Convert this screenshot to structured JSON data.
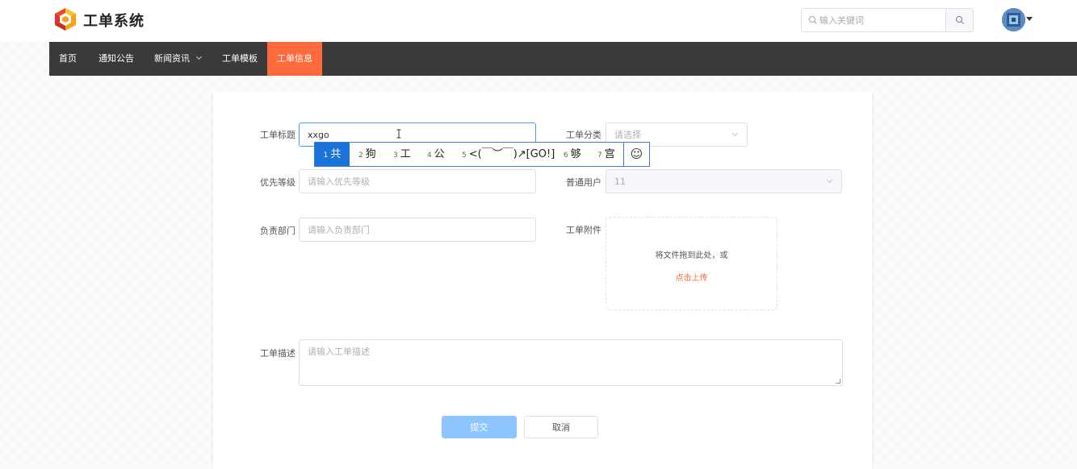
{
  "header": {
    "brand": "工单系统",
    "search_placeholder": "输入关键词"
  },
  "nav": {
    "items": [
      {
        "label": "首页"
      },
      {
        "label": "通知公告"
      },
      {
        "label": "新闻资讯"
      },
      {
        "label": "工单模板"
      },
      {
        "label": "工单信息"
      }
    ],
    "active": "工单信息"
  },
  "form": {
    "title_label": "工单标题",
    "title_value": "xxgo",
    "category_label": "工单分类",
    "category_placeholder": "请选择",
    "priority_label": "优先等级",
    "priority_placeholder": "请输入优先等级",
    "user_label": "普通用户",
    "user_value": "11",
    "dept_label": "负责部门",
    "dept_placeholder": "请输入负责部门",
    "attach_label": "工单附件",
    "attach_text": "将文件拖到此处，或",
    "attach_link": "点击上传",
    "desc_label": "工单描述",
    "desc_placeholder": "请输入工单描述",
    "submit": "提交",
    "cancel": "取消"
  },
  "ime": {
    "candidates": [
      {
        "num": "1",
        "text": "共"
      },
      {
        "num": "2",
        "text": "狗"
      },
      {
        "num": "3",
        "text": "工"
      },
      {
        "num": "4",
        "text": "公"
      },
      {
        "num": "5",
        "text": "<(￣︶￣)↗[GO!]"
      },
      {
        "num": "6",
        "text": "够"
      },
      {
        "num": "7",
        "text": "宫"
      }
    ],
    "emoji": "☺"
  }
}
